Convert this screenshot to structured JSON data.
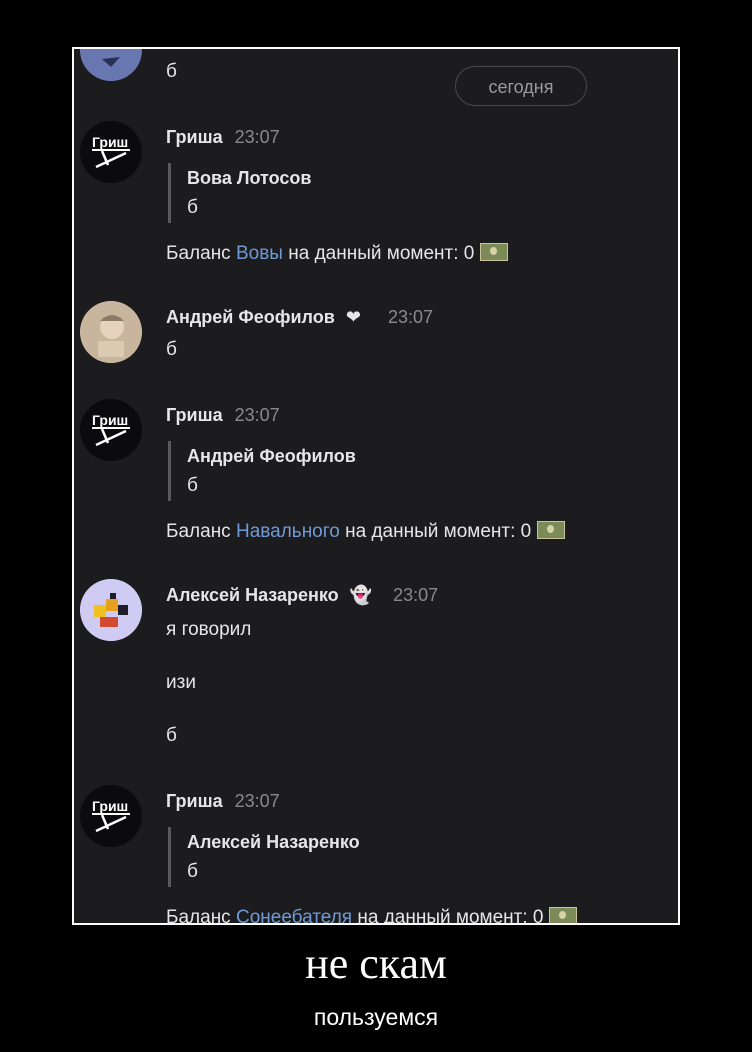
{
  "date_pill": "сегодня",
  "top_fragment": "б",
  "messages": [
    {
      "author": "Гриша",
      "time": "23:07",
      "reply_author": "Вова Лотосов",
      "reply_text": "б",
      "balance_prefix": "Баланс ",
      "balance_link": "Вовы",
      "balance_suffix": " на данный момент: 0"
    },
    {
      "author": "Андрей Феофилов",
      "time": "23:07",
      "lines": [
        "б"
      ]
    },
    {
      "author": "Гриша",
      "time": "23:07",
      "reply_author": "Андрей Феофилов",
      "reply_text": "б",
      "balance_prefix": "Баланс ",
      "balance_link": "Навального",
      "balance_suffix": " на данный момент: 0"
    },
    {
      "author": "Алексей Назаренко",
      "time": "23:07",
      "lines": [
        "я говорил",
        "изи",
        "б"
      ]
    },
    {
      "author": "Гриша",
      "time": "23:07",
      "reply_author": "Алексей Назаренко",
      "reply_text": "б",
      "balance_prefix": "Баланс ",
      "balance_link": "Сонеебателя",
      "balance_suffix": " на данный момент: 0"
    }
  ],
  "caption": {
    "title": "не скам",
    "subtitle": "пользуемся"
  },
  "icons": [
    "grisha-logo-avatar",
    "user-photo-avatar",
    "pixel-art-avatar",
    "heart-icon",
    "ghost-icon",
    "money-icon"
  ],
  "colors": {
    "background": "#000000",
    "chat_bg": "#1c1c1e",
    "link": "#6f9ad6",
    "text": "#e6e6e8",
    "muted": "#8a8a8e"
  }
}
